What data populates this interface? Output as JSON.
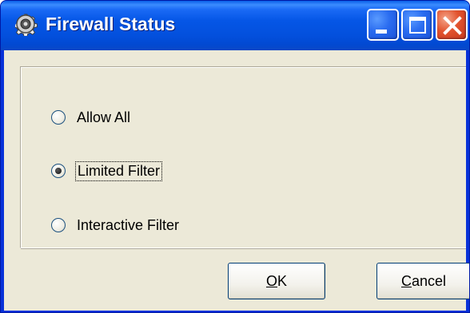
{
  "window": {
    "title": "Firewall Status",
    "icons": [
      "gear-icon",
      "minimize-icon",
      "maximize-icon",
      "close-icon"
    ],
    "colors": {
      "titlebar": "#0556e6",
      "client": "#ece9d8",
      "close_button": "#e2532e"
    }
  },
  "options": [
    {
      "label": "Allow All",
      "selected": false
    },
    {
      "label": "Limited Filter",
      "selected": true
    },
    {
      "label": "Interactive Filter",
      "selected": false
    }
  ],
  "buttons": {
    "ok": {
      "mnemonic": "O",
      "rest": "K"
    },
    "cancel": {
      "mnemonic": "C",
      "rest": "ancel"
    }
  }
}
